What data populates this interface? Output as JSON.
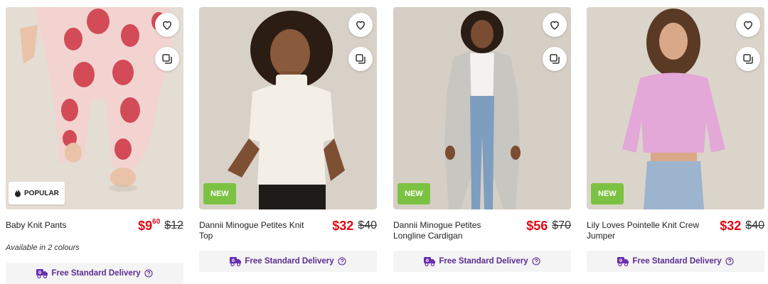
{
  "products": [
    {
      "name": "Baby Knit Pants",
      "price_dollars": "$9",
      "price_cents": "60",
      "was_price": "$12",
      "badge": "POPULAR",
      "colours_note": "Available in 2 colours",
      "delivery_label": "Free Standard Delivery"
    },
    {
      "name": "Dannii Minogue Petites Knit Top",
      "price_dollars": "$32",
      "price_cents": "",
      "was_price": "$40",
      "badge": "NEW",
      "delivery_label": "Free Standard Delivery"
    },
    {
      "name": "Dannii Minogue Petites Longline Cardigan",
      "price_dollars": "$56",
      "price_cents": "",
      "was_price": "$70",
      "badge": "NEW",
      "delivery_label": "Free Standard Delivery"
    },
    {
      "name": "Lily Loves Pointelle Knit Crew Jumper",
      "price_dollars": "$32",
      "price_cents": "",
      "was_price": "$40",
      "badge": "NEW",
      "delivery_label": "Free Standard Delivery"
    }
  ],
  "icons": {
    "wishlist": "heart-icon",
    "quick_view": "quick-view-icon",
    "popular": "flame-icon",
    "delivery": "truck-icon",
    "help": "help-circle-icon"
  },
  "colors": {
    "sale_price": "#e30613",
    "new_badge": "#7cc242",
    "delivery_text": "#5c2d91",
    "delivery_bg": "#f4f4f4",
    "photo_bg": "#d9d2c9"
  }
}
